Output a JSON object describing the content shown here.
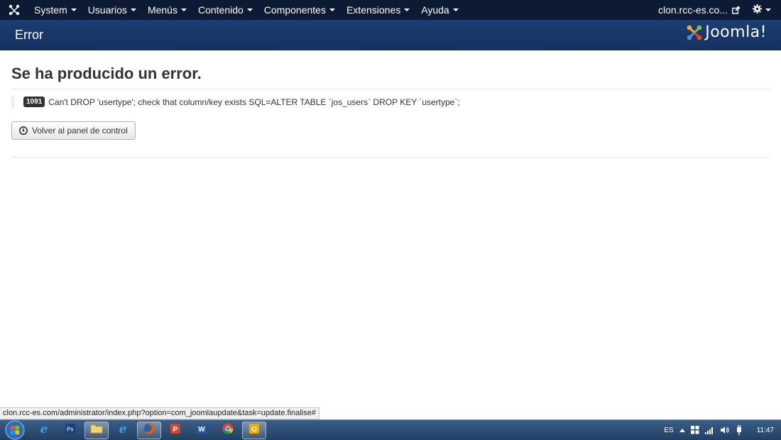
{
  "navbar": {
    "menu": [
      {
        "label": "System"
      },
      {
        "label": "Usuarios"
      },
      {
        "label": "Menús"
      },
      {
        "label": "Contenido"
      },
      {
        "label": "Componentes"
      },
      {
        "label": "Extensiones"
      },
      {
        "label": "Ayuda"
      }
    ],
    "site_link": "clon.rcc-es.co..."
  },
  "header": {
    "title": "Error",
    "logo_text": "Joomla!"
  },
  "main": {
    "heading": "Se ha producido un error.",
    "error_code": "1091",
    "error_message": "Can't DROP 'usertype'; check that column/key exists SQL=ALTER TABLE `jos_users` DROP KEY `usertype`;",
    "back_button_label": "Volver al panel de control"
  },
  "status_url": "clon.rcc-es.com/administrator/index.php?option=com_joomlaupdate&task=update.finalise#",
  "taskbar": {
    "apps": [
      {
        "name": "internet-explorer-icon"
      },
      {
        "name": "photoshop-icon"
      },
      {
        "name": "file-explorer-icon"
      },
      {
        "name": "internet-explorer-icon"
      },
      {
        "name": "firefox-icon"
      },
      {
        "name": "powerpoint-icon"
      },
      {
        "name": "word-icon"
      },
      {
        "name": "chrome-icon"
      },
      {
        "name": "outlook-icon"
      }
    ],
    "language": "ES",
    "time": "11:47"
  },
  "colors": {
    "navbar_bg": "#0c1a33",
    "header_bg": "#16325f",
    "badge_bg": "#333333",
    "taskbar_bg": "#233f63"
  }
}
